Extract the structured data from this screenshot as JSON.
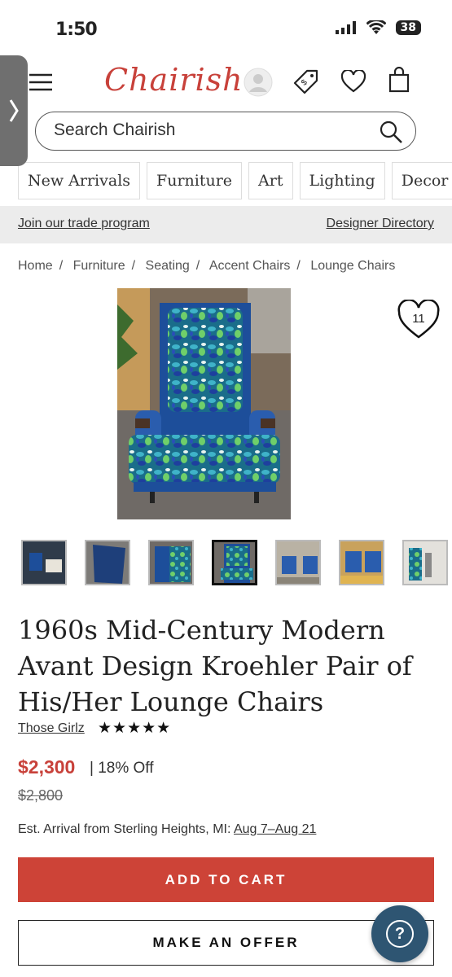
{
  "status": {
    "time": "1:50",
    "battery": "38"
  },
  "header": {
    "logo": "Chairish"
  },
  "search": {
    "placeholder": "Search Chairish"
  },
  "categories": [
    "New Arrivals",
    "Furniture",
    "Art",
    "Lighting",
    "Decor"
  ],
  "trade": {
    "join_label": "Join our trade program",
    "directory_label": "Designer Directory"
  },
  "breadcrumb": [
    "Home",
    "Furniture",
    "Seating",
    "Accent Chairs",
    "Lounge Chairs"
  ],
  "product": {
    "favorites": "11",
    "title": "1960s Mid-Century Modern Avant Design Kroehler Pair of His/Her Lounge Chairs",
    "seller": "Those Girlz",
    "stars": "★★★★★",
    "price": "$2,300",
    "discount": "| 18% Off",
    "old_price": "$2,800",
    "arrival_label": "Est. Arrival from Sterling Heights, MI:",
    "arrival_dates": "Aug 7–Aug 21",
    "add_to_cart": "ADD TO CART",
    "make_offer": "MAKE AN OFFER",
    "help": "?"
  },
  "icons": [
    "hamburger-icon",
    "account-icon",
    "price-tag-icon",
    "heart-icon",
    "shopping-bag-icon",
    "search-icon",
    "chevron-right-icon",
    "help-icon"
  ]
}
